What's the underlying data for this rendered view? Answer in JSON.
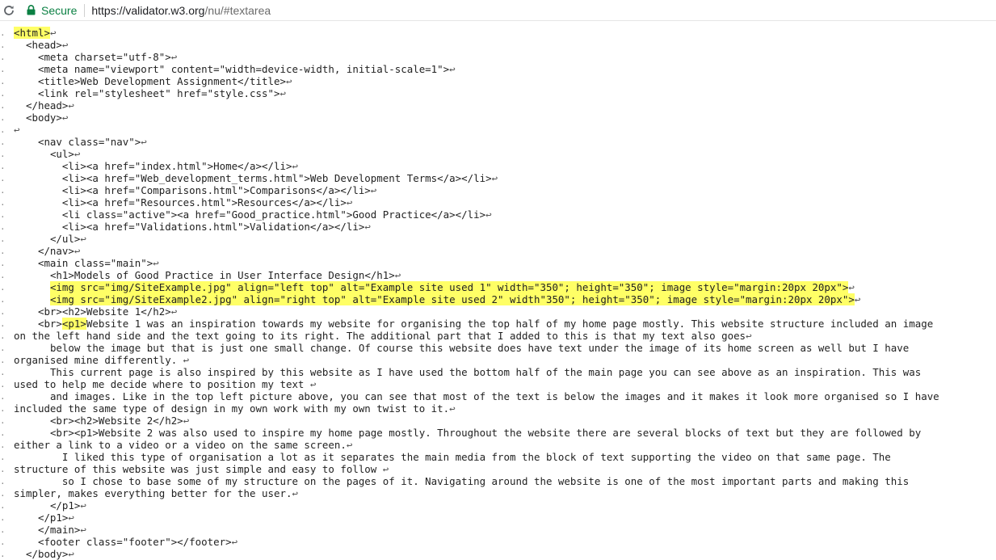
{
  "browser": {
    "secure_label": "Secure",
    "url_scheme_host": "https://validator.w3.org",
    "url_path": "/nu/#textarea"
  },
  "colors": {
    "highlight": "#ffff66",
    "secure_green": "#0b8043",
    "code_text": "#222222"
  },
  "icons": {
    "reload": "reload-icon",
    "lock": "lock-icon",
    "line_break": "carriage-return-glyph"
  },
  "source_lines": [
    {
      "indent": "",
      "text": "",
      "hl": "<html>",
      "rest": "",
      "cr": "↩"
    },
    {
      "indent": "  ",
      "text": "<head>",
      "hl": "",
      "rest": "",
      "cr": "↩"
    },
    {
      "indent": "    ",
      "text": "<meta charset=\"utf-8\">",
      "hl": "",
      "rest": "",
      "cr": "↩"
    },
    {
      "indent": "    ",
      "text": "<meta name=\"viewport\" content=\"width=device-width, initial-scale=1\">",
      "hl": "",
      "rest": "",
      "cr": "↩"
    },
    {
      "indent": "    ",
      "text": "<title>Web Development Assignment</title>",
      "hl": "",
      "rest": "",
      "cr": "↩"
    },
    {
      "indent": "    ",
      "text": "<link rel=\"stylesheet\" href=\"style.css\">",
      "hl": "",
      "rest": "",
      "cr": "↩"
    },
    {
      "indent": "  ",
      "text": "</head>",
      "hl": "",
      "rest": "",
      "cr": "↩"
    },
    {
      "indent": "  ",
      "text": "<body>",
      "hl": "",
      "rest": "",
      "cr": "↩"
    },
    {
      "indent": "",
      "text": "",
      "hl": "",
      "rest": "",
      "cr": "↩"
    },
    {
      "indent": "    ",
      "text": "<nav class=\"nav\">",
      "hl": "",
      "rest": "",
      "cr": "↩"
    },
    {
      "indent": "      ",
      "text": "<ul>",
      "hl": "",
      "rest": "",
      "cr": "↩"
    },
    {
      "indent": "        ",
      "text": "<li><a href=\"index.html\">Home</a></li>",
      "hl": "",
      "rest": "",
      "cr": "↩"
    },
    {
      "indent": "        ",
      "text": "<li><a href=\"Web_development_terms.html\">Web Development Terms</a></li>",
      "hl": "",
      "rest": "",
      "cr": "↩"
    },
    {
      "indent": "        ",
      "text": "<li><a href=\"Comparisons.html\">Comparisons</a></li>",
      "hl": "",
      "rest": "",
      "cr": "↩"
    },
    {
      "indent": "        ",
      "text": "<li><a href=\"Resources.html\">Resources</a></li>",
      "hl": "",
      "rest": "",
      "cr": "↩"
    },
    {
      "indent": "        ",
      "text": "<li class=\"active\"><a href=\"Good_practice.html\">Good Practice</a></li>",
      "hl": "",
      "rest": "",
      "cr": "↩"
    },
    {
      "indent": "        ",
      "text": "<li><a href=\"Validations.html\">Validation</a></li>",
      "hl": "",
      "rest": "",
      "cr": "↩"
    },
    {
      "indent": "      ",
      "text": "</ul>",
      "hl": "",
      "rest": "",
      "cr": "↩"
    },
    {
      "indent": "    ",
      "text": "</nav>",
      "hl": "",
      "rest": "",
      "cr": "↩"
    },
    {
      "indent": "    ",
      "text": "<main class=\"main\">",
      "hl": "",
      "rest": "",
      "cr": "↩"
    },
    {
      "indent": "      ",
      "text": "<h1>Models of Good Practice in User Interface Design</h1>",
      "hl": "",
      "rest": "",
      "cr": "↩"
    },
    {
      "indent": "      ",
      "text": "",
      "hl": "<img src=\"img/SiteExample.jpg\" align=\"left top\" alt=\"Example site used 1\" width=\"350\"; height=\"350\"; image style=\"margin:20px 20px\">",
      "rest": "",
      "cr": "↩"
    },
    {
      "indent": "      ",
      "text": "",
      "hl": "<img src=\"img/SiteExample2.jpg\" align=\"right top\" alt=\"Example site used 2\" width\"350\"; height=\"350\"; image style=\"margin:20px 20px\">",
      "rest": "",
      "cr": "↩"
    },
    {
      "indent": "    ",
      "text": "<br><h2>Website 1</h2>",
      "hl": "",
      "rest": "",
      "cr": "↩"
    },
    {
      "indent": "    ",
      "text": "<br>",
      "hl": "<p1>",
      "rest": "Website 1 was an inspiration towards my website for organising the top half of my home page mostly. This website structure included an image",
      "cr": ""
    },
    {
      "indent": "",
      "text": "on the left hand side and the text going to its right. The additional part that I added to this is that my text also goes",
      "hl": "",
      "rest": "",
      "cr": "↩"
    },
    {
      "indent": "      ",
      "text": "below the image but that is just one small change. Of course this website does have text under the image of its home screen as well but I have",
      "hl": "",
      "rest": "",
      "cr": ""
    },
    {
      "indent": "",
      "text": "organised mine differently. ",
      "hl": "",
      "rest": "",
      "cr": "↩"
    },
    {
      "indent": "      ",
      "text": "This current page is also inspired by this website as I have used the bottom half of the main page you can see above as an inspiration. This was",
      "hl": "",
      "rest": "",
      "cr": ""
    },
    {
      "indent": "",
      "text": "used to help me decide where to position my text ",
      "hl": "",
      "rest": "",
      "cr": "↩"
    },
    {
      "indent": "      ",
      "text": "and images. Like in the top left picture above, you can see that most of the text is below the images and it makes it look more organised so I have",
      "hl": "",
      "rest": "",
      "cr": ""
    },
    {
      "indent": "",
      "text": "included the same type of design in my own work with my own twist to it.",
      "hl": "",
      "rest": "",
      "cr": "↩"
    },
    {
      "indent": "      ",
      "text": "<br><h2>Website 2</h2>",
      "hl": "",
      "rest": "",
      "cr": "↩"
    },
    {
      "indent": "      ",
      "text": "<br><p1>Website 2 was also used to inspire my home page mostly. Throughout the website there are several blocks of text but they are followed by",
      "hl": "",
      "rest": "",
      "cr": ""
    },
    {
      "indent": "",
      "text": "either a link to a video or a video on the same screen.",
      "hl": "",
      "rest": "",
      "cr": "↩"
    },
    {
      "indent": "        ",
      "text": "I liked this type of organisation a lot as it separates the main media from the block of text supporting the video on that same page. The",
      "hl": "",
      "rest": "",
      "cr": ""
    },
    {
      "indent": "",
      "text": "structure of this website was just simple and easy to follow ",
      "hl": "",
      "rest": "",
      "cr": "↩"
    },
    {
      "indent": "        ",
      "text": "so I chose to base some of my structure on the pages of it. Navigating around the website is one of the most important parts and making this",
      "hl": "",
      "rest": "",
      "cr": ""
    },
    {
      "indent": "",
      "text": "simpler, makes everything better for the user.",
      "hl": "",
      "rest": "",
      "cr": "↩"
    },
    {
      "indent": "      ",
      "text": "</p1>",
      "hl": "",
      "rest": "",
      "cr": "↩"
    },
    {
      "indent": "    ",
      "text": "</p1>",
      "hl": "",
      "rest": "",
      "cr": "↩"
    },
    {
      "indent": "    ",
      "text": "</main>",
      "hl": "",
      "rest": "",
      "cr": "↩"
    },
    {
      "indent": "    ",
      "text": "<footer class=\"footer\"></footer>",
      "hl": "",
      "rest": "",
      "cr": "↩"
    },
    {
      "indent": "  ",
      "text": "</body>",
      "hl": "",
      "rest": "",
      "cr": "↩"
    }
  ]
}
